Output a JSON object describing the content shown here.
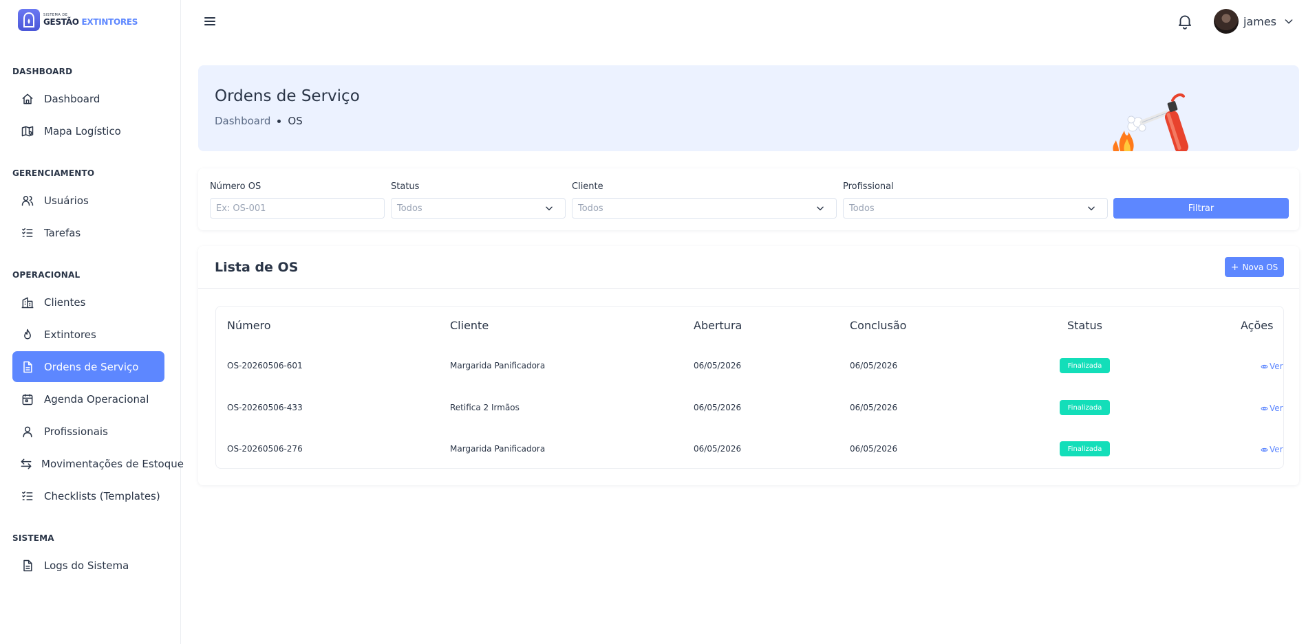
{
  "logo": {
    "small": "SISTEMA DE",
    "brand_main": "GESTÃO",
    "brand_accent": "EXTINTORES"
  },
  "sidebar": {
    "sections": [
      {
        "title": "DASHBOARD"
      },
      {
        "title": "GERENCIAMENTO"
      },
      {
        "title": "OPERACIONAL"
      },
      {
        "title": "SISTEMA"
      }
    ],
    "items": [
      {
        "label": "Dashboard",
        "icon": "home-icon"
      },
      {
        "label": "Mapa Logístico",
        "icon": "map-icon"
      },
      {
        "label": "Usuários",
        "icon": "users-icon"
      },
      {
        "label": "Tarefas",
        "icon": "list-check-icon"
      },
      {
        "label": "Clientes",
        "icon": "building-icon"
      },
      {
        "label": "Extintores",
        "icon": "flame-icon"
      },
      {
        "label": "Ordens de Serviço",
        "icon": "file-text-icon",
        "active": true
      },
      {
        "label": "Agenda Operacional",
        "icon": "calendar-icon"
      },
      {
        "label": "Profissionais",
        "icon": "user-icon"
      },
      {
        "label": "Movimentações de Estoque",
        "icon": "transfer-icon"
      },
      {
        "label": "Checklists (Templates)",
        "icon": "list-check-icon"
      },
      {
        "label": "Logs do Sistema",
        "icon": "file-text-icon"
      }
    ]
  },
  "header": {
    "username": "james"
  },
  "banner": {
    "title": "Ordens de Serviço",
    "breadcrumb": [
      "Dashboard",
      "OS"
    ]
  },
  "filters": {
    "numero_label": "Número OS",
    "numero_placeholder": "Ex: OS-001",
    "status_label": "Status",
    "status_value": "Todos",
    "cliente_label": "Cliente",
    "cliente_value": "Todos",
    "profissional_label": "Profissional",
    "profissional_value": "Todos",
    "button": "Filtrar"
  },
  "list": {
    "title": "Lista de OS",
    "new_button": "Nova OS",
    "columns": [
      "Número",
      "Cliente",
      "Abertura",
      "Conclusão",
      "Status",
      "Ações"
    ],
    "rows": [
      {
        "numero": "OS-20260506-601",
        "cliente": "Margarida Panificadora",
        "abertura": "06/05/2026",
        "conclusao": "06/05/2026",
        "status": "Finalizada",
        "acao": "Ver"
      },
      {
        "numero": "OS-20260506-433",
        "cliente": "Retifica 2 Irmãos",
        "abertura": "06/05/2026",
        "conclusao": "06/05/2026",
        "status": "Finalizada",
        "acao": "Ver"
      },
      {
        "numero": "OS-20260506-276",
        "cliente": "Margarida Panificadora",
        "abertura": "06/05/2026",
        "conclusao": "06/05/2026",
        "status": "Finalizada",
        "acao": "Ver"
      }
    ]
  },
  "colors": {
    "primary": "#5d87ff",
    "success": "#13deb9",
    "banner_bg": "#ecf2ff",
    "text": "#2a3547"
  }
}
